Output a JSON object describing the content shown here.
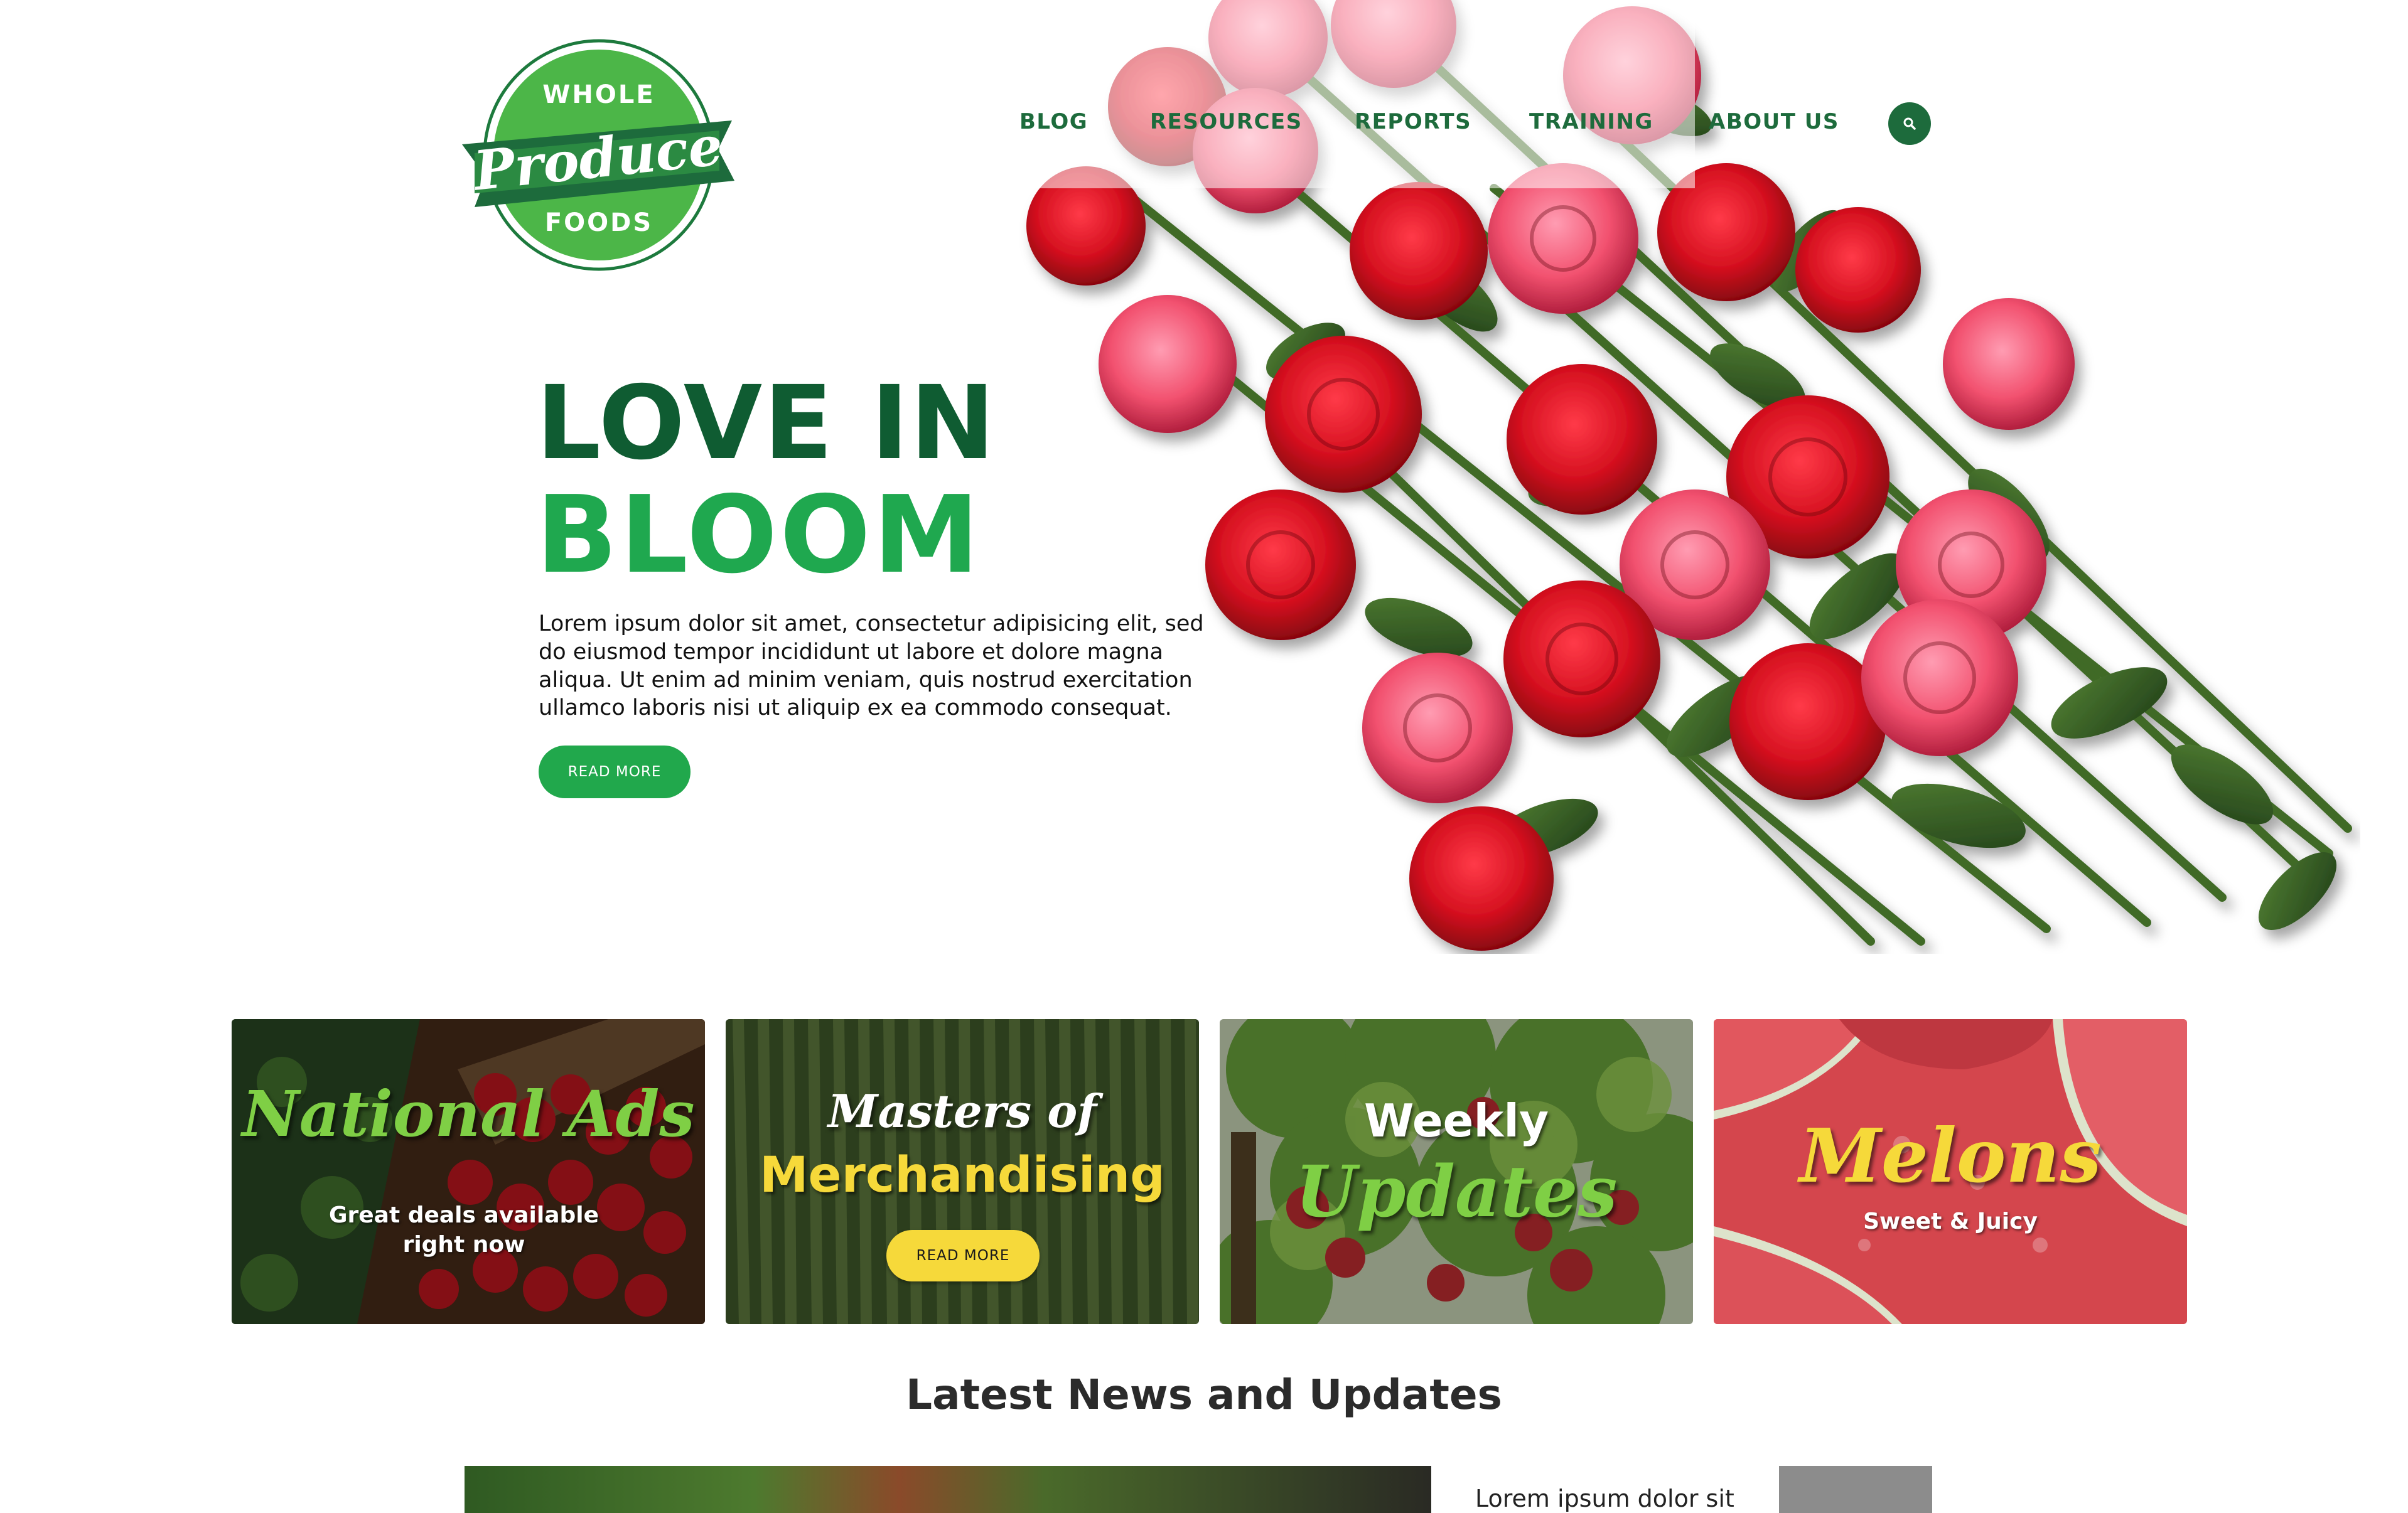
{
  "colors": {
    "brand_dark_green": "#0f5c32",
    "brand_green": "#1fa84f",
    "nav_green": "#1d6b3c",
    "accent_yellow": "#f6d93a",
    "script_green": "#7fcf45"
  },
  "logo": {
    "top_text": "WHOLE",
    "middle_text": "Produce",
    "bottom_text": "FOODS"
  },
  "nav": {
    "items": [
      {
        "label": "BLOG"
      },
      {
        "label": "RESOURCES"
      },
      {
        "label": "REPORTS"
      },
      {
        "label": "TRAINING"
      },
      {
        "label": "ABOUT US"
      }
    ],
    "search_icon": "search-icon"
  },
  "hero": {
    "title_line1": "LOVE IN",
    "title_line2": "BLOOM",
    "body": "Lorem ipsum dolor sit amet, consectetur adipisicing elit, sed do eiusmod tempor incididunt ut labore et dolore magna aliqua. Ut enim ad minim veniam, quis nostrud exercitation ullamco laboris nisi ut aliquip ex ea commodo consequat.",
    "button_label": "READ MORE"
  },
  "cards": [
    {
      "title": "National Ads",
      "subtitle": "Great deals available right now"
    },
    {
      "title_line1": "Masters of",
      "title_line2": "Merchandising",
      "button_label": "READ MORE"
    },
    {
      "title_line1": "Weekly",
      "title_line2": "Updates"
    },
    {
      "title": "Melons",
      "subtitle": "Sweet & Juicy"
    }
  ],
  "news": {
    "heading": "Latest News and Updates",
    "item_title": "Lorem ipsum dolor sit"
  }
}
